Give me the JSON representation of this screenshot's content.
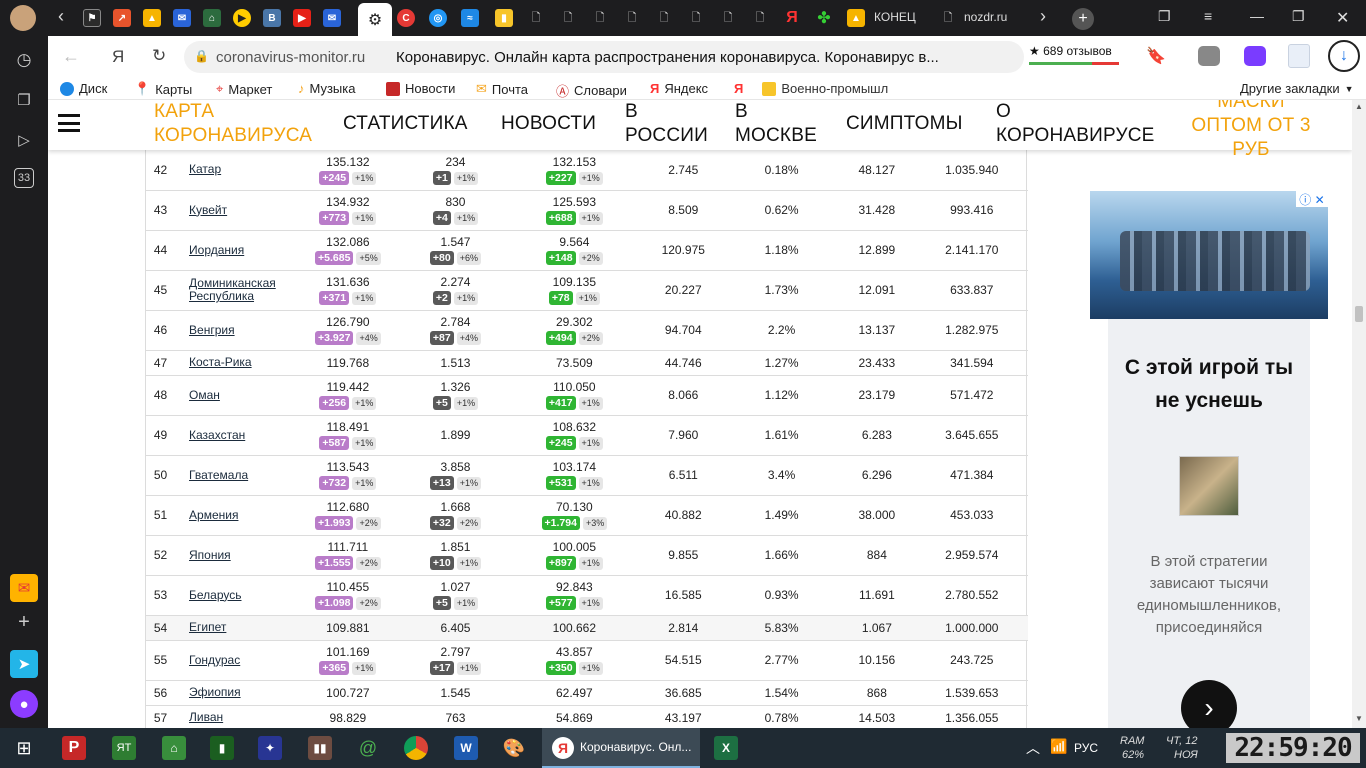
{
  "tabs": {
    "konets": "КОНЕЦ",
    "nozdr": "nozdr.ru",
    "ya": "Я"
  },
  "addressbar": {
    "url": "coronavirus-monitor.ru",
    "page_title": "Коронавирус. Онлайн карта распространения коронавируса. Коронавирус в...",
    "reviews": "★ 689 отзывов",
    "ya": "Я"
  },
  "bookmarks": {
    "items": [
      "Диск",
      "Карты",
      "Маркет",
      "Музыка",
      "Новости",
      "Почта",
      "Словари",
      "Яндекс",
      "Военно-промышл"
    ],
    "other": "Другие закладки"
  },
  "sidebar": {
    "badge": "33"
  },
  "nav": {
    "items": [
      "КАРТА КОРОНАВИРУСА",
      "СТАТИСТИКА",
      "НОВОСТИ",
      "В РОССИИ",
      "В МОСКВЕ",
      "СИМПТОМЫ",
      "О КОРОНАВИРУСЕ",
      "МАСКИ ОПТОМ ОТ 3 РУБ"
    ]
  },
  "table": {
    "rows": [
      {
        "n": "42",
        "country": "Катар",
        "cases": "135.132",
        "cases_new": "+245",
        "cases_pct": "+1%",
        "deaths": "234",
        "deaths_new": "+1",
        "deaths_pct": "+1%",
        "recovered": "132.153",
        "rec_new": "+227",
        "rec_pct": "+1%",
        "active": "2.745",
        "rate": "0.18%",
        "per_m": "48.127",
        "tests": "1.035.940"
      },
      {
        "n": "43",
        "country": "Кувейт",
        "cases": "134.932",
        "cases_new": "+773",
        "cases_pct": "+1%",
        "deaths": "830",
        "deaths_new": "+4",
        "deaths_pct": "+1%",
        "recovered": "125.593",
        "rec_new": "+688",
        "rec_pct": "+1%",
        "active": "8.509",
        "rate": "0.62%",
        "per_m": "31.428",
        "tests": "993.416"
      },
      {
        "n": "44",
        "country": "Иордания",
        "cases": "132.086",
        "cases_new": "+5.685",
        "cases_pct": "+5%",
        "deaths": "1.547",
        "deaths_new": "+80",
        "deaths_pct": "+6%",
        "recovered": "9.564",
        "rec_new": "+148",
        "rec_pct": "+2%",
        "active": "120.975",
        "rate": "1.18%",
        "per_m": "12.899",
        "tests": "2.141.170"
      },
      {
        "n": "45",
        "country": "Доминиканская Республика",
        "cases": "131.636",
        "cases_new": "+371",
        "cases_pct": "+1%",
        "deaths": "2.274",
        "deaths_new": "+2",
        "deaths_pct": "+1%",
        "recovered": "109.135",
        "rec_new": "+78",
        "rec_pct": "+1%",
        "active": "20.227",
        "rate": "1.73%",
        "per_m": "12.091",
        "tests": "633.837"
      },
      {
        "n": "46",
        "country": "Венгрия",
        "cases": "126.790",
        "cases_new": "+3.927",
        "cases_pct": "+4%",
        "deaths": "2.784",
        "deaths_new": "+87",
        "deaths_pct": "+4%",
        "recovered": "29.302",
        "rec_new": "+494",
        "rec_pct": "+2%",
        "active": "94.704",
        "rate": "2.2%",
        "per_m": "13.137",
        "tests": "1.282.975"
      },
      {
        "n": "47",
        "country": "Коста-Рика",
        "cases": "119.768",
        "cases_new": "",
        "cases_pct": "",
        "deaths": "1.513",
        "deaths_new": "",
        "deaths_pct": "",
        "recovered": "73.509",
        "rec_new": "",
        "rec_pct": "",
        "active": "44.746",
        "rate": "1.27%",
        "per_m": "23.433",
        "tests": "341.594"
      },
      {
        "n": "48",
        "country": "Оман",
        "cases": "119.442",
        "cases_new": "+256",
        "cases_pct": "+1%",
        "deaths": "1.326",
        "deaths_new": "+5",
        "deaths_pct": "+1%",
        "recovered": "110.050",
        "rec_new": "+417",
        "rec_pct": "+1%",
        "active": "8.066",
        "rate": "1.12%",
        "per_m": "23.179",
        "tests": "571.472"
      },
      {
        "n": "49",
        "country": "Казахстан",
        "cases": "118.491",
        "cases_new": "+587",
        "cases_pct": "+1%",
        "deaths": "1.899",
        "deaths_new": "",
        "deaths_pct": "",
        "recovered": "108.632",
        "rec_new": "+245",
        "rec_pct": "+1%",
        "active": "7.960",
        "rate": "1.61%",
        "per_m": "6.283",
        "tests": "3.645.655"
      },
      {
        "n": "50",
        "country": "Гватемала",
        "cases": "113.543",
        "cases_new": "+732",
        "cases_pct": "+1%",
        "deaths": "3.858",
        "deaths_new": "+13",
        "deaths_pct": "+1%",
        "recovered": "103.174",
        "rec_new": "+531",
        "rec_pct": "+1%",
        "active": "6.511",
        "rate": "3.4%",
        "per_m": "6.296",
        "tests": "471.384"
      },
      {
        "n": "51",
        "country": "Армения",
        "cases": "112.680",
        "cases_new": "+1.993",
        "cases_pct": "+2%",
        "deaths": "1.668",
        "deaths_new": "+32",
        "deaths_pct": "+2%",
        "recovered": "70.130",
        "rec_new": "+1.794",
        "rec_pct": "+3%",
        "active": "40.882",
        "rate": "1.49%",
        "per_m": "38.000",
        "tests": "453.033"
      },
      {
        "n": "52",
        "country": "Япония",
        "cases": "111.711",
        "cases_new": "+1.555",
        "cases_pct": "+2%",
        "deaths": "1.851",
        "deaths_new": "+10",
        "deaths_pct": "+1%",
        "recovered": "100.005",
        "rec_new": "+897",
        "rec_pct": "+1%",
        "active": "9.855",
        "rate": "1.66%",
        "per_m": "884",
        "tests": "2.959.574"
      },
      {
        "n": "53",
        "country": "Беларусь",
        "cases": "110.455",
        "cases_new": "+1.098",
        "cases_pct": "+2%",
        "deaths": "1.027",
        "deaths_new": "+5",
        "deaths_pct": "+1%",
        "recovered": "92.843",
        "rec_new": "+577",
        "rec_pct": "+1%",
        "active": "16.585",
        "rate": "0.93%",
        "per_m": "11.691",
        "tests": "2.780.552"
      },
      {
        "n": "54",
        "country": "Египет",
        "cases": "109.881",
        "cases_new": "",
        "cases_pct": "",
        "deaths": "6.405",
        "deaths_new": "",
        "deaths_pct": "",
        "recovered": "100.662",
        "rec_new": "",
        "rec_pct": "",
        "active": "2.814",
        "rate": "5.83%",
        "per_m": "1.067",
        "tests": "1.000.000"
      },
      {
        "n": "55",
        "country": "Гондурас",
        "cases": "101.169",
        "cases_new": "+365",
        "cases_pct": "+1%",
        "deaths": "2.797",
        "deaths_new": "+17",
        "deaths_pct": "+1%",
        "recovered": "43.857",
        "rec_new": "+350",
        "rec_pct": "+1%",
        "active": "54.515",
        "rate": "2.77%",
        "per_m": "10.156",
        "tests": "243.725"
      },
      {
        "n": "56",
        "country": "Эфиопия",
        "cases": "100.727",
        "cases_new": "",
        "cases_pct": "",
        "deaths": "1.545",
        "deaths_new": "",
        "deaths_pct": "",
        "recovered": "62.497",
        "rec_new": "",
        "rec_pct": "",
        "active": "36.685",
        "rate": "1.54%",
        "per_m": "868",
        "tests": "1.539.653"
      },
      {
        "n": "57",
        "country": "Ливан",
        "cases": "98.829",
        "cases_new": "",
        "cases_pct": "",
        "deaths": "763",
        "deaths_new": "",
        "deaths_pct": "",
        "recovered": "54.869",
        "rec_new": "",
        "rec_pct": "",
        "active": "43.197",
        "rate": "0.78%",
        "per_m": "14.503",
        "tests": "1.356.055"
      }
    ]
  },
  "ad": {
    "title": "С этой игрой ты не уснешь",
    "desc": "В этой стратегии зависают тысячи единомышленников, присоединяйся"
  },
  "taskbar": {
    "active_title": "Коронавирус. Онл...",
    "lang": "РУС",
    "ram_label": "RAM",
    "ram_value": "62%",
    "day": "ЧТ, 12",
    "month": "НОЯ",
    "clock": "22:59:20"
  },
  "colors": {
    "purple_badge": "#b97cc9",
    "dark_badge": "#595959",
    "green_badge": "#2fb533",
    "nav_accent": "#f2a20c"
  }
}
